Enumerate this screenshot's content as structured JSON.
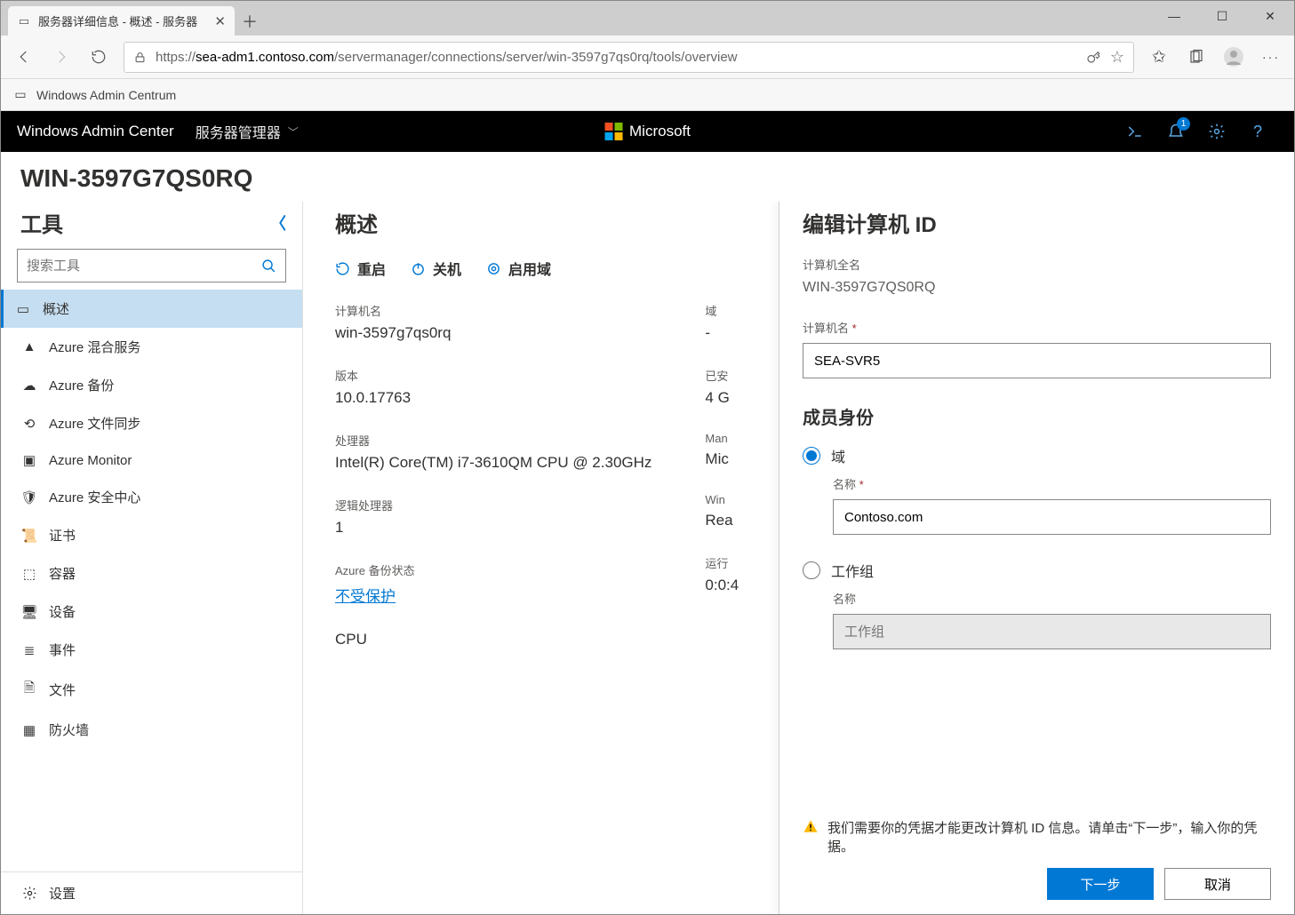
{
  "browser": {
    "tab_title": "服务器详细信息 - 概述 - 服务器",
    "url_prefix": "https://",
    "url_host": "sea-adm1.contoso.com",
    "url_path": "/servermanager/connections/server/win-3597g7qs0rq/tools/overview",
    "bookmark": "Windows Admin Centrum"
  },
  "wac": {
    "brand": "Windows Admin Center",
    "breadcrumb": "服务器管理器",
    "ms_label": "Microsoft",
    "notif_count": "1"
  },
  "server_name": "WIN-3597G7QS0RQ",
  "tools": {
    "heading": "工具",
    "search_placeholder": "搜索工具",
    "items": [
      {
        "label": "概述",
        "icon": "▭"
      },
      {
        "label": "Azure 混合服务",
        "icon": "▲"
      },
      {
        "label": "Azure 备份",
        "icon": "☁"
      },
      {
        "label": "Azure 文件同步",
        "icon": "⟲"
      },
      {
        "label": "Azure Monitor",
        "icon": "▣"
      },
      {
        "label": "Azure 安全中心",
        "icon": "🛡"
      },
      {
        "label": "证书",
        "icon": "📜"
      },
      {
        "label": "容器",
        "icon": "⬚"
      },
      {
        "label": "设备",
        "icon": "🖥"
      },
      {
        "label": "事件",
        "icon": "≣"
      },
      {
        "label": "文件",
        "icon": "🗎"
      },
      {
        "label": "防火墙",
        "icon": "▦"
      }
    ],
    "settings": "设置"
  },
  "overview": {
    "title": "概述",
    "actions": {
      "restart": "重启",
      "shutdown": "关机",
      "enable_domain": "启用域"
    },
    "fields": {
      "computer_name_label": "计算机名",
      "computer_name_value": "win-3597g7qs0rq",
      "domain_label": "域",
      "domain_value": "-",
      "version_label": "版本",
      "version_value": "10.0.17763",
      "installed_label": "已安",
      "installed_value": "4 G",
      "processor_label": "处理器",
      "processor_value": "Intel(R) Core(TM) i7-3610QM CPU @ 2.30GHz",
      "man_label": "Man",
      "man_value": "Mic",
      "logical_label": "逻辑处理器",
      "logical_value": "1",
      "win_label": "Win",
      "win_value": "Rea",
      "azure_backup_label": "Azure 备份状态",
      "azure_backup_value": "不受保护",
      "run_label": "运行",
      "run_value": "0:0:4",
      "cpu_label": "CPU"
    }
  },
  "panel": {
    "title": "编辑计算机 ID",
    "full_name_label": "计算机全名",
    "full_name_value": "WIN-3597G7QS0RQ",
    "computer_name_label": "计算机名",
    "computer_name_value": "SEA-SVR5",
    "membership_heading": "成员身份",
    "radio_domain": "域",
    "domain_name_label": "名称",
    "domain_name_value": "Contoso.com",
    "radio_workgroup": "工作组",
    "workgroup_name_label": "名称",
    "workgroup_placeholder": "工作组",
    "warning_text": "我们需要你的凭据才能更改计算机 ID 信息。请单击“下一步”，输入你的凭据。",
    "btn_next": "下一步",
    "btn_cancel": "取消"
  }
}
